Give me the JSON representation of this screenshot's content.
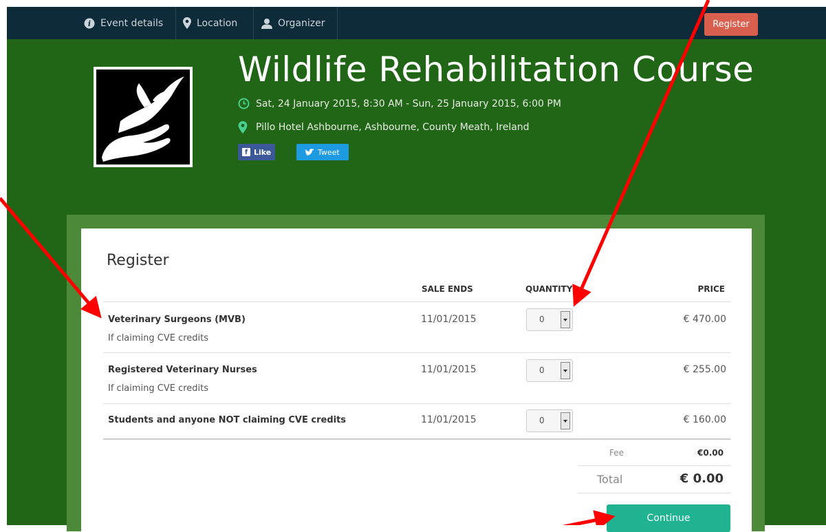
{
  "nav": {
    "items": [
      {
        "label": "Event details",
        "icon": "info-icon"
      },
      {
        "label": "Location",
        "icon": "map-pin-icon"
      },
      {
        "label": "Organizer",
        "icon": "person-icon"
      }
    ],
    "register_label": "Register"
  },
  "event": {
    "title": "Wildlife Rehabilitation Course",
    "datetime": "Sat, 24 January 2015, 8:30 AM - Sun, 25 January 2015, 6:00 PM",
    "location": "Pillo Hotel Ashbourne, Ashbourne, County Meath, Ireland",
    "like_label": "Like",
    "tweet_label": "Tweet"
  },
  "register": {
    "heading": "Register",
    "columns": {
      "sale_ends": "SALE ENDS",
      "quantity": "QUANTITY",
      "price": "PRICE"
    },
    "tickets": [
      {
        "name": "Veterinary Surgeons (MVB)",
        "note": "If claiming CVE credits",
        "sale_ends": "11/01/2015",
        "quantity": "0",
        "price": "€ 470.00"
      },
      {
        "name": "Registered Veterinary Nurses",
        "note": "If claiming CVE credits",
        "sale_ends": "11/01/2015",
        "quantity": "0",
        "price": "€ 255.00"
      },
      {
        "name": "Students and anyone NOT claiming CVE credits",
        "note": "",
        "sale_ends": "11/01/2015",
        "quantity": "0",
        "price": "€ 160.00"
      }
    ],
    "fee_label": "Fee",
    "fee_value": "€0.00",
    "total_label": "Total",
    "total_value": "€ 0.00",
    "continue_label": "Continue"
  },
  "colors": {
    "nav_bg": "#0e2b3a",
    "banner_green": "#216616",
    "register_button": "#d9604e",
    "continue_button": "#1fb392",
    "annotation_arrow": "#ff0000"
  }
}
